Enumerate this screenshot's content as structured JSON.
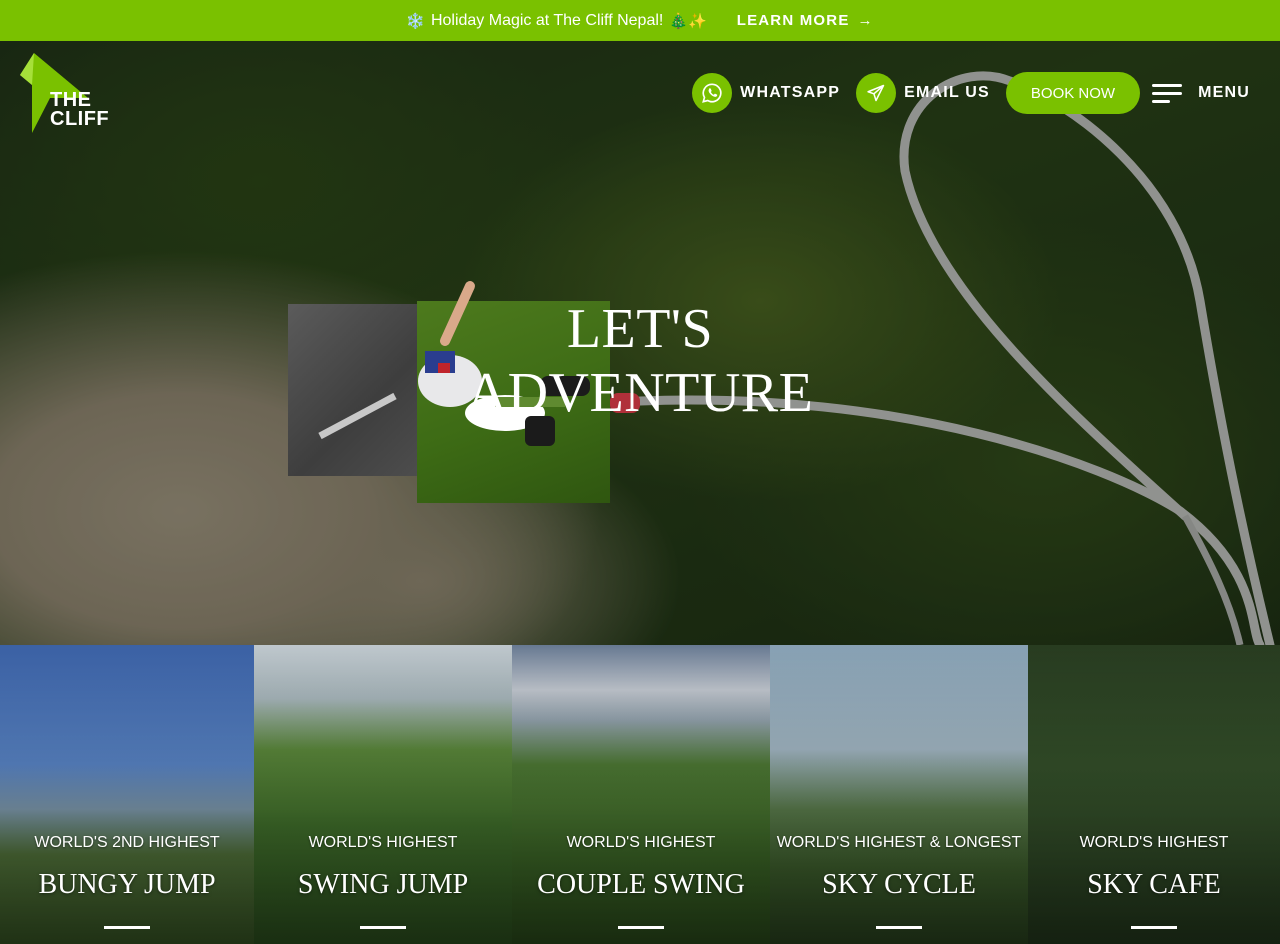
{
  "announcement": {
    "snow_glyph": "❄️",
    "text": "Holiday Magic at The Cliff Nepal!",
    "end_glyphs": "🎄✨",
    "link_label": "LEARN MORE",
    "arrow_glyph": "→"
  },
  "logo": {
    "line1": "THE",
    "line2": "CLIFF"
  },
  "header": {
    "whatsapp_label": "WHATSAPP",
    "email_label": "EMAIL US",
    "book_label": "BOOK NOW",
    "menu_label": "MENU"
  },
  "hero": {
    "title_line1": "LET'S",
    "title_line2": "ADVENTURE"
  },
  "activities": [
    {
      "subtitle": "WORLD'S 2ND HIGHEST",
      "title": "BUNGY JUMP"
    },
    {
      "subtitle": "WORLD'S HIGHEST",
      "title": "SWING JUMP"
    },
    {
      "subtitle": "WORLD'S HIGHEST",
      "title": "COUPLE SWING"
    },
    {
      "subtitle": "WORLD'S HIGHEST & LONGEST",
      "title": "SKY CYCLE"
    },
    {
      "subtitle": "WORLD'S HIGHEST",
      "title": "SKY CAFE"
    }
  ],
  "colors": {
    "brand_green": "#7ac100"
  },
  "icons": [
    "whatsapp-icon",
    "telegram-send-icon",
    "hamburger-menu-icon",
    "arrow-right-icon"
  ]
}
